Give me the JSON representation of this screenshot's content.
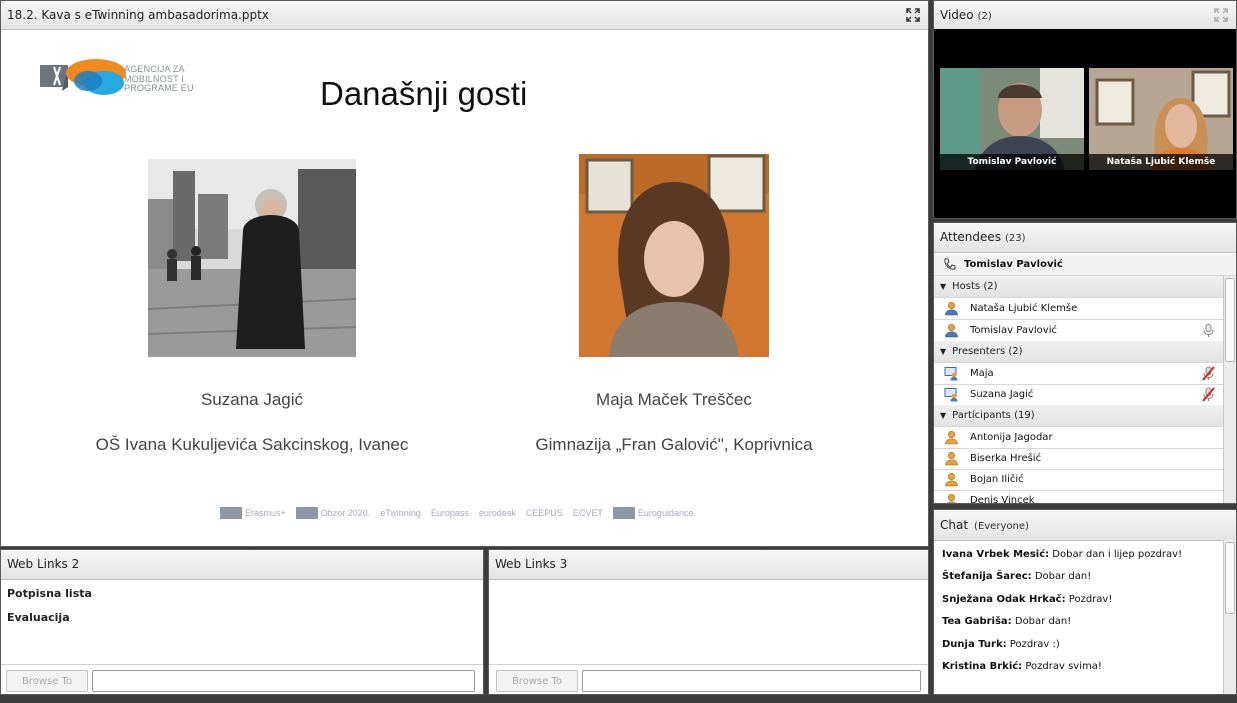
{
  "share_pod": {
    "title": "18.2. Kava s eTwinning ambasadorima.pptx",
    "slide": {
      "logo_text_lines": [
        "AGENCIJA ZA",
        "MOBILNOST I",
        "PROGRAME EU"
      ],
      "title": "Današnji gosti",
      "guests": [
        {
          "name": "Suzana Jagić",
          "school": "OŠ Ivana Kukuljevića Sakcinskog, Ivanec"
        },
        {
          "name": "Maja Maček Treščec",
          "school": "Gimnazija „Fran Galović\", Koprivnica"
        }
      ],
      "sponsors": [
        "Erasmus+",
        "Obzor 2020.",
        "eTwinning",
        "Europass",
        "eurodesk",
        "CEEPUS",
        "ECVET",
        "Euroguidance"
      ]
    }
  },
  "video_pod": {
    "title": "Video",
    "count": "(2)",
    "tiles": [
      {
        "name": "Tomislav Pavlović"
      },
      {
        "name": "Nataša Ljubić Klemše"
      }
    ]
  },
  "attendees_pod": {
    "title": "Attendees",
    "count": "(23)",
    "current_user": "Tomislav Pavlović",
    "groups": [
      {
        "label": "Hosts (2)",
        "members": [
          "Nataša Ljubić Klemše",
          "Tomislav Pavlović"
        ]
      },
      {
        "label": "Presenters (2)",
        "members": [
          "Maja",
          "Suzana Jagić"
        ]
      },
      {
        "label": "Participants (19)",
        "members": [
          "Antonija Jagodar",
          "Biserka Hrešić",
          "Bojan Iličić",
          "Denis Vincek"
        ]
      }
    ]
  },
  "chat_pod": {
    "title": "Chat",
    "scope": "(Everyone)",
    "messages": [
      {
        "author": "Ivana Vrbek Mesić:",
        "text": " Dobar dan i lijep pozdrav!"
      },
      {
        "author": "Štefanija Šarec:",
        "text": " Dobar dan!"
      },
      {
        "author": "Snježana Odak Hrkač:",
        "text": " Pozdrav!"
      },
      {
        "author": "Tea Gabriša:",
        "text": " Dobar dan!"
      },
      {
        "author": "Dunja Turk:",
        "text": " Pozdrav :)"
      },
      {
        "author": "Kristina Brkić:",
        "text": " Pozdrav svima!"
      }
    ]
  },
  "weblinks2": {
    "title": "Web Links 2",
    "links": [
      "Potpisna lista",
      "Evaluacija"
    ],
    "browse_label": "Browse To",
    "url_value": ""
  },
  "weblinks3": {
    "title": "Web Links 3",
    "links": [],
    "browse_label": "Browse To",
    "url_value": ""
  }
}
